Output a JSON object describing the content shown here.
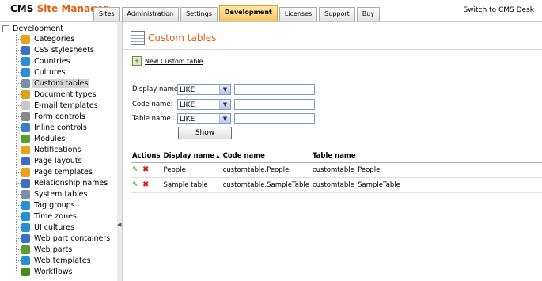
{
  "header": {
    "logo_cms": "CMS",
    "logo_site_manager": "Site Manager",
    "tabs": [
      {
        "label": "Sites"
      },
      {
        "label": "Administration"
      },
      {
        "label": "Settings"
      },
      {
        "label": "Development"
      },
      {
        "label": "Licenses"
      },
      {
        "label": "Support"
      },
      {
        "label": "Buy"
      }
    ],
    "active_tab": "Development",
    "switch_link": "Switch to CMS Desk"
  },
  "sidebar": {
    "root_label": "Development",
    "items": [
      {
        "label": "Categories",
        "icon": "categories-icon",
        "color": "#e6a21a"
      },
      {
        "label": "CSS stylesheets",
        "icon": "css-stylesheets-icon",
        "color": "#3b6fc4"
      },
      {
        "label": "Countries",
        "icon": "globe-icon",
        "color": "#2a8fd0"
      },
      {
        "label": "Cultures",
        "icon": "cultures-icon",
        "color": "#2a8fd0"
      },
      {
        "label": "Custom tables",
        "icon": "table-icon",
        "color": "#7d8fa8"
      },
      {
        "label": "Document types",
        "icon": "document-types-icon",
        "color": "#d8a420"
      },
      {
        "label": "E-mail templates",
        "icon": "email-icon",
        "color": "#c9c9c9"
      },
      {
        "label": "Form controls",
        "icon": "form-controls-icon",
        "color": "#8a8a8a"
      },
      {
        "label": "Inline controls",
        "icon": "inline-controls-icon",
        "color": "#3b7fc4"
      },
      {
        "label": "Modules",
        "icon": "modules-icon",
        "color": "#5a9e2a"
      },
      {
        "label": "Notifications",
        "icon": "notifications-icon",
        "color": "#e6a21a"
      },
      {
        "label": "Page layouts",
        "icon": "page-layouts-icon",
        "color": "#3b6fc4"
      },
      {
        "label": "Page templates",
        "icon": "page-templates-icon",
        "color": "#e6a21a"
      },
      {
        "label": "Relationship names",
        "icon": "relationship-icon",
        "color": "#3b6fc4"
      },
      {
        "label": "System tables",
        "icon": "system-tables-icon",
        "color": "#7d8fa8"
      },
      {
        "label": "Tag groups",
        "icon": "tag-groups-icon",
        "color": "#2a8fd0"
      },
      {
        "label": "Time zones",
        "icon": "time-zones-icon",
        "color": "#2a8fd0"
      },
      {
        "label": "UI cultures",
        "icon": "ui-cultures-icon",
        "color": "#2a8fd0"
      },
      {
        "label": "Web part containers",
        "icon": "web-part-containers-icon",
        "color": "#3b6fc4"
      },
      {
        "label": "Web parts",
        "icon": "web-parts-icon",
        "color": "#5a9e2a"
      },
      {
        "label": "Web templates",
        "icon": "web-templates-icon",
        "color": "#2a8fd0"
      },
      {
        "label": "Workflows",
        "icon": "workflows-icon",
        "color": "#4a8a1a"
      }
    ],
    "selected": "Custom tables"
  },
  "main": {
    "title": "Custom tables",
    "new_link": "New Custom table",
    "filters": [
      {
        "label": "Display name:",
        "operator": "LIKE",
        "value": ""
      },
      {
        "label": "Code name:",
        "operator": "LIKE",
        "value": ""
      },
      {
        "label": "Table name:",
        "operator": "LIKE",
        "value": ""
      }
    ],
    "show_button": "Show",
    "grid": {
      "headers": [
        "Actions",
        "Display name",
        "Code name",
        "Table name"
      ],
      "rows": [
        {
          "display_name": "People",
          "code_name": "customtable.People",
          "table_name": "customtable_People"
        },
        {
          "display_name": "Sample table",
          "code_name": "customtable.SampleTable",
          "table_name": "customtable_SampleTable"
        }
      ]
    }
  },
  "colors": {
    "accent": "#e35d0e",
    "active_tab": "#f7c864"
  }
}
